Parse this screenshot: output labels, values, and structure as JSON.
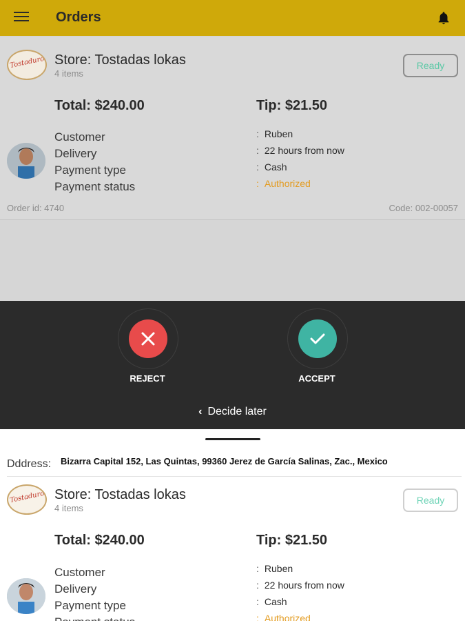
{
  "appbar": {
    "title": "Orders",
    "menu_icon": "hamburger-menu-icon",
    "bell_icon": "notification-bell-icon"
  },
  "order_card": {
    "store": "Store: Tostadas lokas",
    "items": "4 items",
    "status": "Ready",
    "total": "Total: $240.00",
    "tip": "Tip: $21.50",
    "logo_text": "Tostaduro",
    "labels": [
      "Customer",
      "Delivery",
      "Payment type",
      "Payment status"
    ],
    "values": [
      "Ruben",
      "22 hours from now",
      "Cash",
      "Authorized"
    ],
    "order_id": "Order id: 4740",
    "code": "Code: 002-00057"
  },
  "decision": {
    "reject_label": "REJECT",
    "accept_label": "ACCEPT",
    "decide_later": "Decide later"
  },
  "sheet": {
    "address_label": "Dddress:",
    "address_value": "Bizarra Capital 152, Las Quintas, 99360 Jerez de García Salinas, Zac., Mexico"
  },
  "colors": {
    "appbar": "#cfa90a",
    "reject": "#e84b4b",
    "accept": "#3fb4a3",
    "authorized": "#e39b1f",
    "ready": "#5ac8a5"
  }
}
